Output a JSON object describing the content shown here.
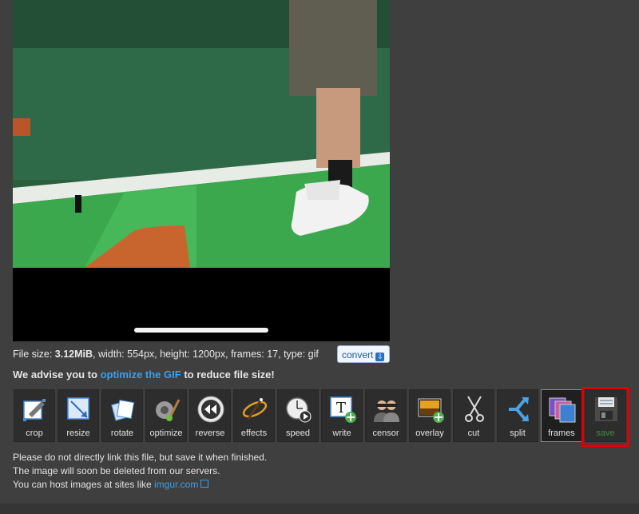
{
  "file_info": {
    "prefix": "File size: ",
    "size": "3.12MiB",
    "details": ", width: 554px, height: 1200px, frames: 17, type: gif",
    "convert_label": "convert"
  },
  "advice": {
    "before": "We advise you to ",
    "link": "optimize the GIF",
    "after": " to reduce file size!"
  },
  "tools": [
    {
      "label": "crop",
      "icon": "crop-icon"
    },
    {
      "label": "resize",
      "icon": "resize-icon"
    },
    {
      "label": "rotate",
      "icon": "rotate-icon"
    },
    {
      "label": "optimize",
      "icon": "optimize-icon"
    },
    {
      "label": "reverse",
      "icon": "reverse-icon"
    },
    {
      "label": "effects",
      "icon": "effects-icon"
    },
    {
      "label": "speed",
      "icon": "speed-icon"
    },
    {
      "label": "write",
      "icon": "write-icon"
    },
    {
      "label": "censor",
      "icon": "censor-icon"
    },
    {
      "label": "overlay",
      "icon": "overlay-icon"
    },
    {
      "label": "cut",
      "icon": "scissors-icon"
    },
    {
      "label": "split",
      "icon": "split-icon"
    },
    {
      "label": "frames",
      "icon": "frames-icon"
    },
    {
      "label": "save",
      "icon": "floppy-disk-icon"
    }
  ],
  "notes": {
    "line1": "Please do not directly link this file, but save it when finished.",
    "line2": "The image will soon be deleted from our servers.",
    "line3_before": "You can host images at sites like ",
    "line3_link": "imgur.com"
  },
  "colors": {
    "background": "#3f3f3f",
    "link": "#3aa0e8",
    "highlight": "#e00000",
    "save_label": "#3c8f3c"
  }
}
